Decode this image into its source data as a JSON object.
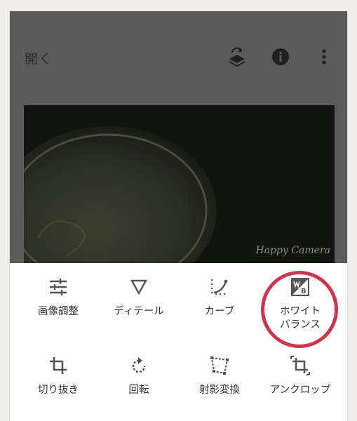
{
  "header": {
    "open_label": "開く"
  },
  "icons": {
    "layers": "layers-swap-icon",
    "info": "info-icon",
    "menu": "more-vert-icon"
  },
  "photo": {
    "watermark": "Happy Camera"
  },
  "tools": [
    {
      "label": "画像調整",
      "icon": "tune-icon"
    },
    {
      "label": "ディテール",
      "icon": "details-triangle-icon"
    },
    {
      "label": "カーブ",
      "icon": "curves-icon"
    },
    {
      "label": "ホワイト\nバランス",
      "icon": "white-balance-icon"
    },
    {
      "label": "切り抜き",
      "icon": "crop-icon"
    },
    {
      "label": "回転",
      "icon": "rotate-icon"
    },
    {
      "label": "射影変換",
      "icon": "perspective-icon"
    },
    {
      "label": "アンクロップ",
      "icon": "expand-icon"
    }
  ],
  "colors": {
    "overlay": "#5b5b5b",
    "highlight_circle": "#d2334c",
    "icon": "#555555"
  }
}
